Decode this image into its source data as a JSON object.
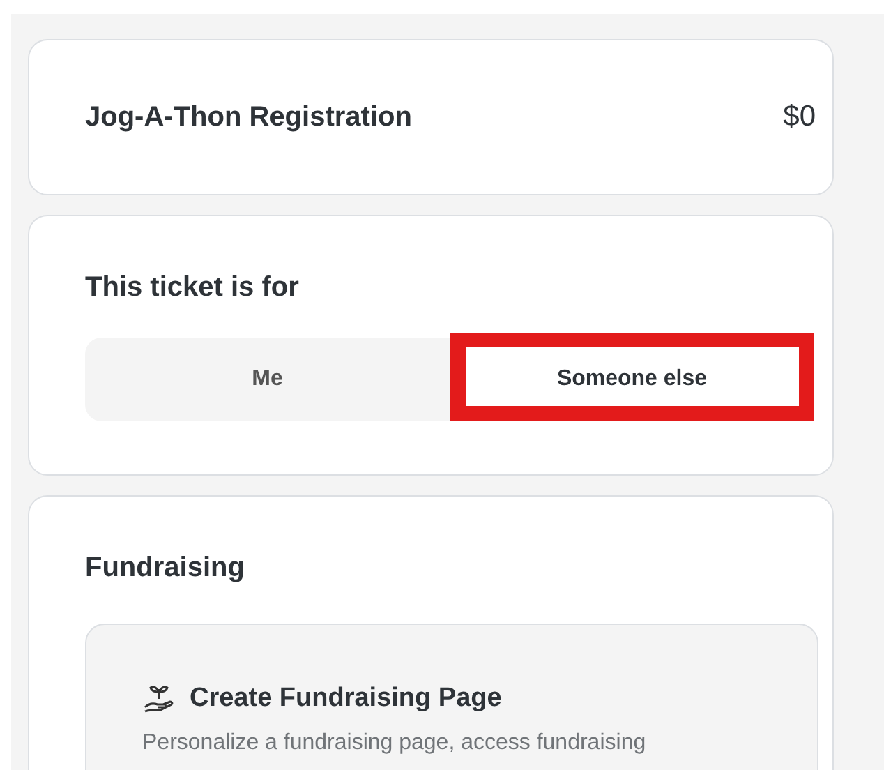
{
  "registration": {
    "title": "Jog-A-Thon Registration",
    "price": "$0"
  },
  "ticket_for": {
    "heading": "This ticket is for",
    "options": [
      {
        "label": "Me",
        "selected": false,
        "highlighted": false
      },
      {
        "label": "Someone else",
        "selected": true,
        "highlighted": true
      }
    ]
  },
  "fundraising": {
    "heading": "Fundraising",
    "card": {
      "title": "Create Fundraising Page",
      "description": "Personalize a fundraising page, access fundraising"
    }
  }
}
